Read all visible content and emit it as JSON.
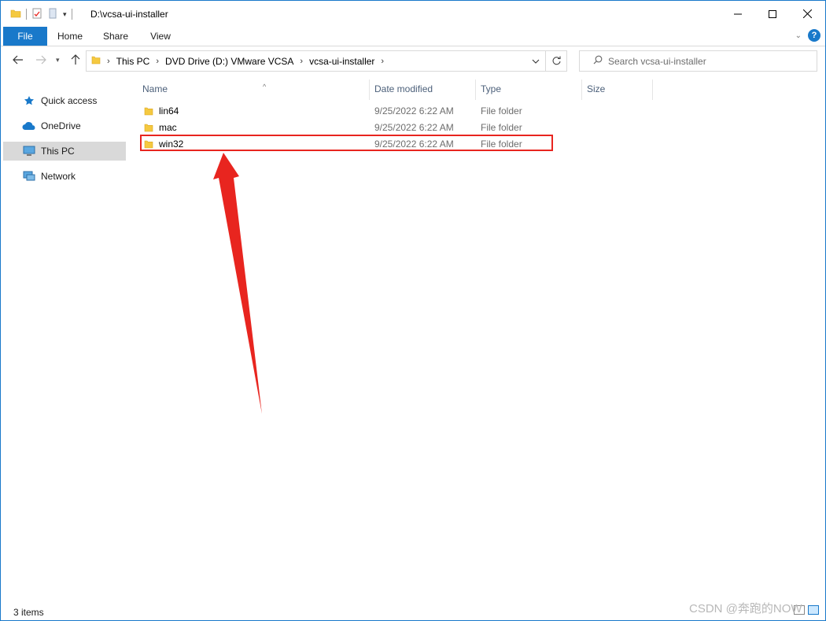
{
  "window": {
    "title": "D:\\vcsa-ui-installer"
  },
  "ribbon": {
    "tabs": [
      "File",
      "Home",
      "Share",
      "View"
    ]
  },
  "address": {
    "crumbs": [
      "This PC",
      "DVD Drive (D:) VMware VCSA",
      "vcsa-ui-installer"
    ]
  },
  "search": {
    "placeholder": "Search vcsa-ui-installer"
  },
  "nav": {
    "items": [
      {
        "label": "Quick access",
        "icon": "star-icon"
      },
      {
        "label": "OneDrive",
        "icon": "cloud-icon"
      },
      {
        "label": "This PC",
        "icon": "computer-icon",
        "selected": true
      },
      {
        "label": "Network",
        "icon": "network-icon"
      }
    ]
  },
  "columns": {
    "name": "Name",
    "date": "Date modified",
    "type": "Type",
    "size": "Size"
  },
  "files": [
    {
      "name": "lin64",
      "date": "9/25/2022 6:22 AM",
      "type": "File folder"
    },
    {
      "name": "mac",
      "date": "9/25/2022 6:22 AM",
      "type": "File folder"
    },
    {
      "name": "win32",
      "date": "9/25/2022 6:22 AM",
      "type": "File folder",
      "highlighted": true
    }
  ],
  "status": {
    "count": "3 items"
  },
  "watermark": "CSDN @奔跑的NOW",
  "colors": {
    "accent": "#1979ca",
    "annotation": "#e8251f",
    "folder": "#f5c940"
  }
}
